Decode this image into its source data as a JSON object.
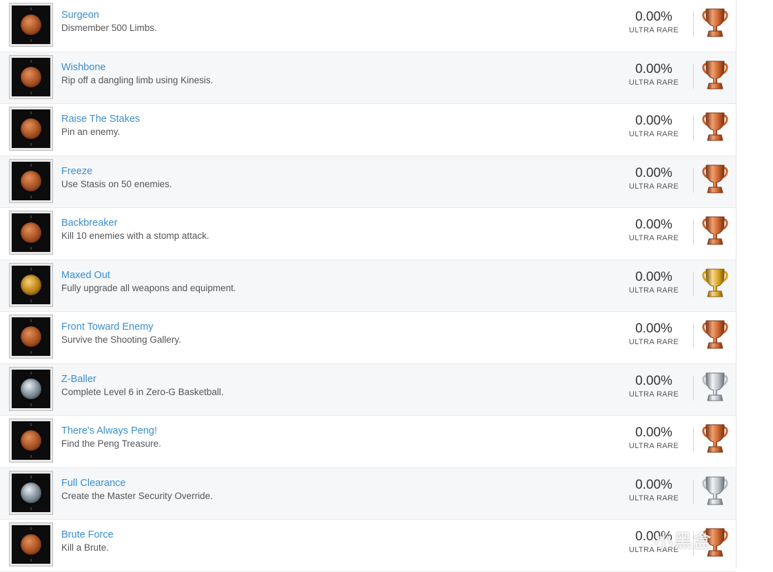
{
  "trophies": [
    {
      "title": "Surgeon",
      "description": "Dismember 500 Limbs.",
      "percent": "0.00%",
      "rarity": "ULTRA RARE",
      "grade": "bronze",
      "icon": "bronze-trophy-icon"
    },
    {
      "title": "Wishbone",
      "description": "Rip off a dangling limb using Kinesis.",
      "percent": "0.00%",
      "rarity": "ULTRA RARE",
      "grade": "bronze",
      "icon": "bronze-trophy-icon"
    },
    {
      "title": "Raise The Stakes",
      "description": "Pin an enemy.",
      "percent": "0.00%",
      "rarity": "ULTRA RARE",
      "grade": "bronze",
      "icon": "bronze-trophy-icon"
    },
    {
      "title": "Freeze",
      "description": "Use Stasis on 50 enemies.",
      "percent": "0.00%",
      "rarity": "ULTRA RARE",
      "grade": "bronze",
      "icon": "bronze-trophy-icon"
    },
    {
      "title": "Backbreaker",
      "description": "Kill 10 enemies with a stomp attack.",
      "percent": "0.00%",
      "rarity": "ULTRA RARE",
      "grade": "bronze",
      "icon": "bronze-trophy-icon"
    },
    {
      "title": "Maxed Out",
      "description": "Fully upgrade all weapons and equipment.",
      "percent": "0.00%",
      "rarity": "ULTRA RARE",
      "grade": "gold",
      "icon": "gold-trophy-icon"
    },
    {
      "title": "Front Toward Enemy",
      "description": "Survive the Shooting Gallery.",
      "percent": "0.00%",
      "rarity": "ULTRA RARE",
      "grade": "bronze",
      "icon": "bronze-trophy-icon"
    },
    {
      "title": "Z-Baller",
      "description": "Complete Level 6 in Zero-G Basketball.",
      "percent": "0.00%",
      "rarity": "ULTRA RARE",
      "grade": "silver",
      "icon": "silver-trophy-icon"
    },
    {
      "title": "There's Always Peng!",
      "description": "Find the Peng Treasure.",
      "percent": "0.00%",
      "rarity": "ULTRA RARE",
      "grade": "bronze",
      "icon": "bronze-trophy-icon"
    },
    {
      "title": "Full Clearance",
      "description": "Create the Master Security Override.",
      "percent": "0.00%",
      "rarity": "ULTRA RARE",
      "grade": "silver",
      "icon": "silver-trophy-icon"
    },
    {
      "title": "Brute Force",
      "description": "Kill a Brute.",
      "percent": "0.00%",
      "rarity": "ULTRA RARE",
      "grade": "bronze",
      "icon": "bronze-trophy-icon"
    }
  ],
  "grade_colors": {
    "bronze": {
      "light": "#f0a070",
      "mid": "#c8622c",
      "dark": "#7a3414"
    },
    "gold": {
      "light": "#f8d890",
      "mid": "#d4a020",
      "dark": "#8a6008"
    },
    "silver": {
      "light": "#f2f4f6",
      "mid": "#b8bec4",
      "dark": "#6c747a"
    }
  },
  "watermark": "小黑盒"
}
